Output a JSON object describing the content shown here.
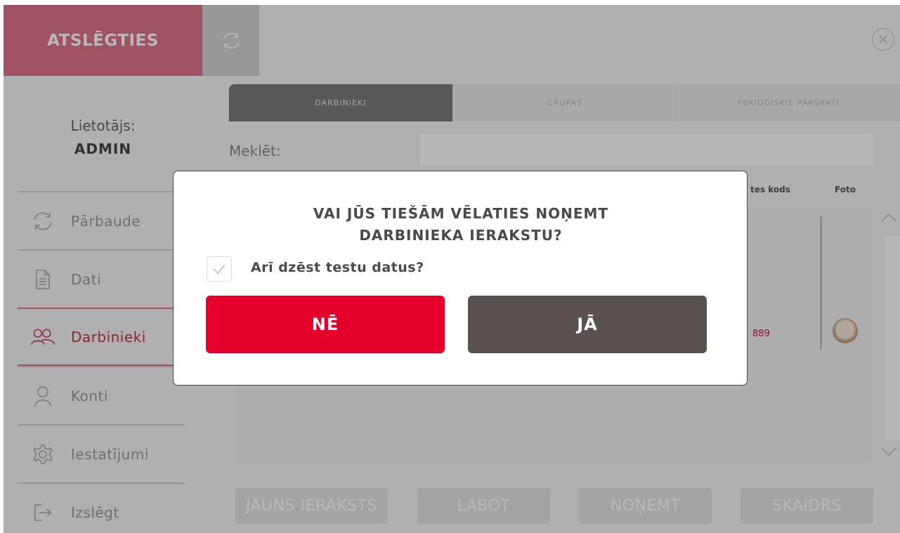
{
  "app": {
    "brand": "ATSLĒGTIES"
  },
  "user": {
    "label": "Lietotājs:",
    "name": "ADMIN"
  },
  "sidebar": {
    "items": [
      {
        "label": "Pārbaude",
        "icon": "refresh-icon",
        "active": false
      },
      {
        "label": "Dati",
        "icon": "document-icon",
        "active": false
      },
      {
        "label": "Darbinieki",
        "icon": "users-icon",
        "active": true
      },
      {
        "label": "Konti",
        "icon": "user-icon",
        "active": false
      },
      {
        "label": "Iestatījumi",
        "icon": "gear-icon",
        "active": false
      },
      {
        "label": "Izslēgt",
        "icon": "logout-icon",
        "active": false
      }
    ]
  },
  "tabs": [
    {
      "label": "DARBINIEKI",
      "active": true
    },
    {
      "label": "GRUPAS",
      "active": false
    },
    {
      "label": "PERIODISKIE PĀRSKATI",
      "active": false
    }
  ],
  "search": {
    "label": "Meklēt:",
    "value": ""
  },
  "table": {
    "headers": {
      "code": "tes kods",
      "photo": "Foto"
    },
    "rows": [
      {
        "code": "889"
      }
    ]
  },
  "actions": {
    "new": "JAUNS IERAKSTS",
    "edit": "LABOT",
    "remove": "NOŅEMT",
    "clear": "SKAIDRS"
  },
  "dialog": {
    "title_line1": "VAI JŪS TIEŠĀM VĒLATIES NOŅEMT",
    "title_line2": "DARBINIEKA IERAKSTU?",
    "checkbox_label": "Arī dzēst testu datus?",
    "checkbox_checked": true,
    "no_label": "NĒ",
    "yes_label": "JĀ"
  },
  "colors": {
    "brand": "#e0748a",
    "accent": "#c5334d",
    "danger": "#e4002b",
    "dark_button": "#585150"
  }
}
